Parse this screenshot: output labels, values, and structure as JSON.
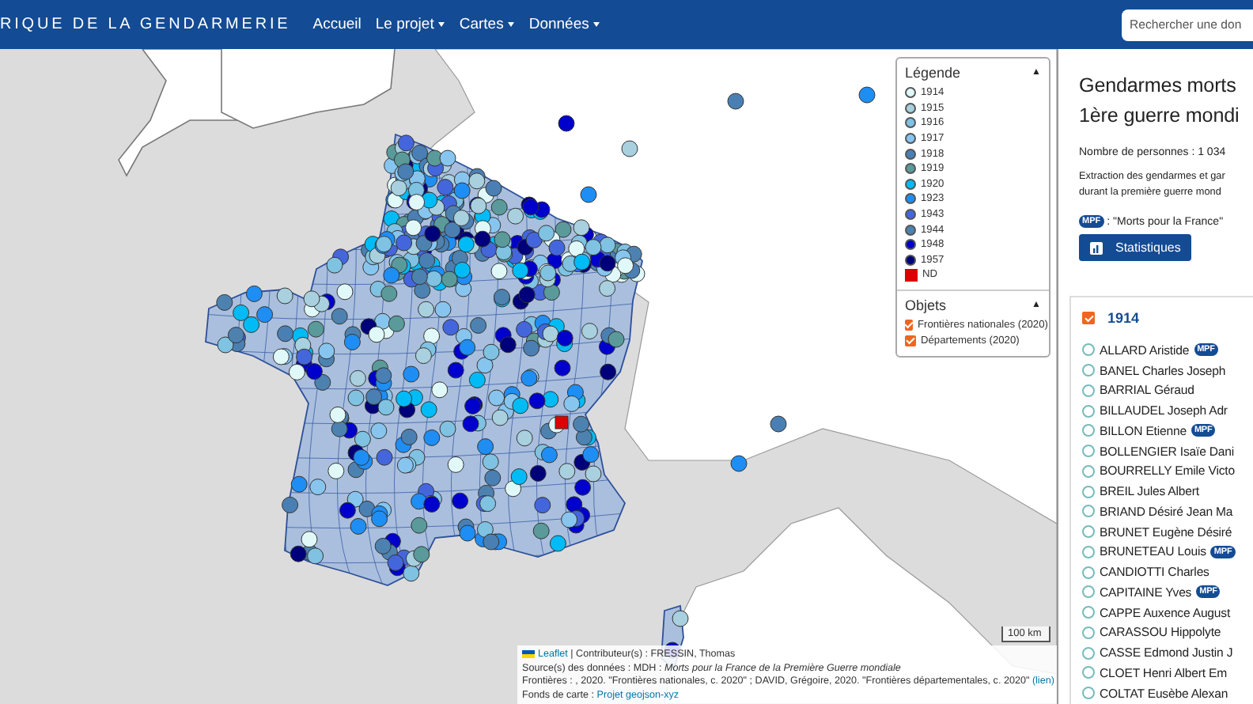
{
  "navbar": {
    "brand": "RIQUE DE LA GENDARMERIE",
    "menu": [
      {
        "label": "Accueil",
        "dropdown": false
      },
      {
        "label": "Le projet",
        "dropdown": true
      },
      {
        "label": "Cartes",
        "dropdown": true
      },
      {
        "label": "Données",
        "dropdown": true
      }
    ],
    "search": {
      "placeholder": "Rechercher une don"
    }
  },
  "map": {
    "legend": {
      "title": "Légende",
      "toggle": "▲",
      "items": [
        {
          "label": "1914",
          "color": "#e0f8f8",
          "kind": "circle"
        },
        {
          "label": "1915",
          "color": "#a8d0de",
          "kind": "circle"
        },
        {
          "label": "1916",
          "color": "#7fc2e2",
          "kind": "circle"
        },
        {
          "label": "1917",
          "color": "#87c5ef",
          "kind": "circle"
        },
        {
          "label": "1918",
          "color": "#4a7fb3",
          "kind": "circle"
        },
        {
          "label": "1919",
          "color": "#5a9a9a",
          "kind": "circle"
        },
        {
          "label": "1920",
          "color": "#00bbf5",
          "kind": "circle"
        },
        {
          "label": "1923",
          "color": "#1e8ef5",
          "kind": "circle"
        },
        {
          "label": "1943",
          "color": "#4466dd",
          "kind": "circle"
        },
        {
          "label": "1944",
          "color": "#4d82b0",
          "kind": "circle"
        },
        {
          "label": "1948",
          "color": "#0000cc",
          "kind": "circle"
        },
        {
          "label": "1957",
          "color": "#00007a",
          "kind": "circle"
        },
        {
          "label": "ND",
          "color": "#dd0000",
          "kind": "square"
        }
      ]
    },
    "layers": {
      "title": "Objets",
      "toggle": "▲",
      "items": [
        {
          "label": "Frontières nationales (2020)",
          "checked": true
        },
        {
          "label": "Départements (2020)",
          "checked": true
        }
      ]
    },
    "scale": "100 km",
    "attribution": [
      [
        {
          "kind": "flag"
        },
        {
          "kind": "link",
          "text": "Leaflet"
        },
        {
          "kind": "text",
          "text": " | Contributeur(s) : FRESSIN, Thomas"
        }
      ],
      [
        {
          "kind": "text",
          "text": "Source(s) des données : MDH : *Morts pour la France de la Première Guerre mondiale*"
        }
      ],
      [
        {
          "kind": "text",
          "text": "Frontières : , 2020. \"Frontières nationales, c. 2020\" ; DAVID, Grégoire, 2020. \"Frontières départementales, c. 2020\" "
        },
        {
          "kind": "link",
          "text": "(lien)"
        }
      ],
      [
        {
          "kind": "text",
          "text": "Fonds de carte : "
        },
        {
          "kind": "link",
          "text": "Projet geojson-xyz"
        }
      ]
    ]
  },
  "panel": {
    "title_lines": [
      "Gendarmes morts",
      "1ère guerre mondi"
    ],
    "count": "Nombre de personnes : 1 034",
    "description_lines": [
      "Extraction des gendarmes et gar",
      "durant la première guerre mond"
    ],
    "badge_note": {
      "badge": "MPF",
      "text": ": \"Morts pour la France\""
    },
    "stats_button": "Statistiques",
    "group": {
      "label": "1914",
      "checked": true,
      "people": [
        {
          "name": "ALLARD Aristide",
          "badge": "MPF",
          "selected": false
        },
        {
          "name": "BANEL Charles Joseph",
          "selected": false
        },
        {
          "name": "BARRIAL Géraud",
          "selected": false
        },
        {
          "name": "BILLAUDEL Joseph Adr",
          "selected": false
        },
        {
          "name": "BILLON Etienne",
          "badge": "MPF",
          "selected": false
        },
        {
          "name": "BOLLENGIER Isaïe Dani",
          "selected": false
        },
        {
          "name": "BOURRELLY Emile Victo",
          "selected": false
        },
        {
          "name": "BREIL Jules Albert",
          "selected": false
        },
        {
          "name": "BRIAND Désiré Jean Ma",
          "selected": false
        },
        {
          "name": "BRUNET Eugène Désiré",
          "selected": false
        },
        {
          "name": "BRUNETEAU Louis",
          "badge": "MPF",
          "selected": false
        },
        {
          "name": "CANDIOTTI Charles",
          "selected": false
        },
        {
          "name": "CAPITAINE Yves",
          "badge": "MPF",
          "selected": false
        },
        {
          "name": "CAPPE Auxence August",
          "selected": false
        },
        {
          "name": "CARASSOU Hippolyte",
          "selected": false
        },
        {
          "name": "CASSE Edmond Justin J",
          "selected": false
        },
        {
          "name": "CLOET Henri Albert Em",
          "selected": false
        },
        {
          "name": "COLTAT Eusèbe Alexan",
          "selected": false
        }
      ]
    }
  }
}
